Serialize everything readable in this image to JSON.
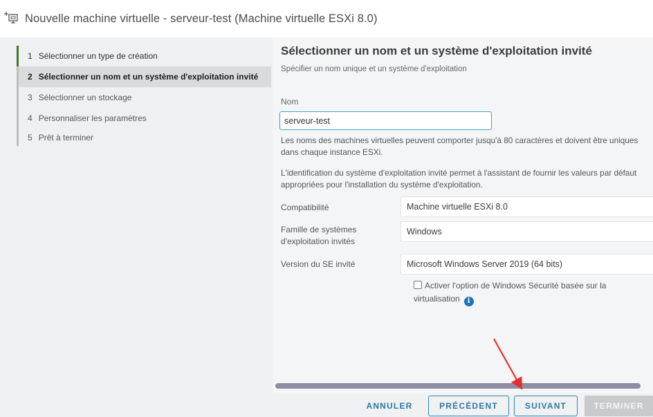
{
  "window": {
    "title": "Nouvelle machine virtuelle - serveur-test (Machine virtuelle ESXi 8.0)",
    "icon": "new-vm-icon"
  },
  "steps": [
    {
      "num": "1",
      "label": "Sélectionner un type de création",
      "state": "done"
    },
    {
      "num": "2",
      "label": "Sélectionner un nom et un système d'exploitation invité",
      "state": "active"
    },
    {
      "num": "3",
      "label": "Sélectionner un stockage",
      "state": "pending"
    },
    {
      "num": "4",
      "label": "Personnaliser les paramètres",
      "state": "pending"
    },
    {
      "num": "5",
      "label": "Prêt à terminer",
      "state": "pending"
    }
  ],
  "main": {
    "title": "Sélectionner un nom et un système d'exploitation invité",
    "subtitle": "Spécifier un nom unique et un système d'exploitation",
    "name_label": "Nom",
    "name_value": "serveur-test",
    "help_name": "Les noms des machines virtuelles peuvent comporter jusqu'à 80 caractères et doivent être uniques dans chaque instance ESXi.",
    "help_os": "L'identification du système d'exploitation invité permet à l'assistant de fournir les valeurs par défaut appropriées pour l'installation du système d'exploitation.",
    "rows": [
      {
        "label": "Compatibilité",
        "value": "Machine virtuelle ESXi 8.0"
      },
      {
        "label": "Famille de systèmes d'exploitation invités",
        "value": "Windows"
      },
      {
        "label": "Version du SE invité",
        "value": "Microsoft Windows Server 2019 (64 bits)"
      }
    ],
    "vbs_label": "Activer l'option de Windows Sécurité basée sur la virtualisation",
    "vbs_checked": false
  },
  "footer": {
    "cancel": "ANNULER",
    "previous": "PRÉCÉDENT",
    "next": "SUIVANT",
    "finish": "TERMINER"
  },
  "colors": {
    "accent": "#2a78a8",
    "done_step": "#3b7a28",
    "input_focus": "#3aa3c9",
    "annotation_arrow": "#e53030"
  }
}
